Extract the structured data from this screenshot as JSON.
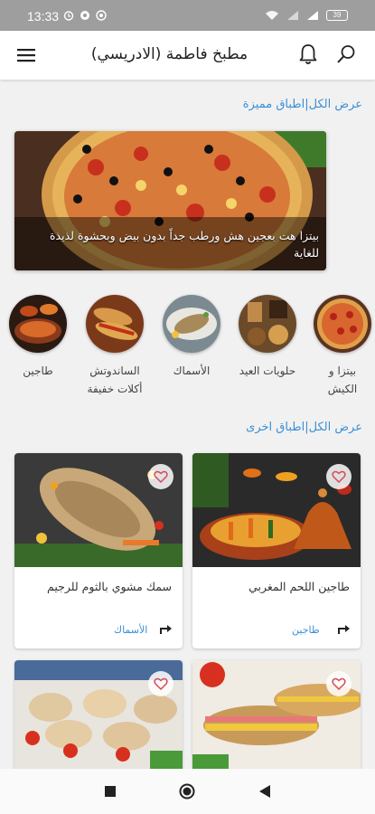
{
  "status": {
    "time": "13:33",
    "battery": "39"
  },
  "app": {
    "title": "مطبخ فاطمة (الادريسي)"
  },
  "featured_section": {
    "link": "عرض الكل|اطباق مميزة"
  },
  "featured": {
    "caption": "بيتزا هت بعجين هش ورطب جداً بدون بيض وبحشوة لذيذة للغاية"
  },
  "categories": [
    {
      "label": "بيتزا و الكيش"
    },
    {
      "label": "حلويات العيد"
    },
    {
      "label": "الأسماك"
    },
    {
      "label": "الساندوتش أكلات خفيفة"
    },
    {
      "label": "طاجين"
    }
  ],
  "other_section": {
    "link": "عرض الكل|اطباق اخرى"
  },
  "recipes": [
    {
      "name": "طاجين اللحم المغربي",
      "category": "طاجين"
    },
    {
      "name": "سمك مشوي بالثوم للرجيم",
      "category": "الأسماك"
    },
    {
      "name": "",
      "category": ""
    },
    {
      "name": "",
      "category": ""
    }
  ],
  "colors": {
    "accent": "#3a8fd6",
    "status_bar": "#9e9e9e"
  },
  "icons": [
    "menu-icon",
    "bell-icon",
    "search-icon",
    "heart-icon",
    "share-icon",
    "nav-back-icon",
    "nav-home-icon",
    "nav-recents-icon"
  ]
}
